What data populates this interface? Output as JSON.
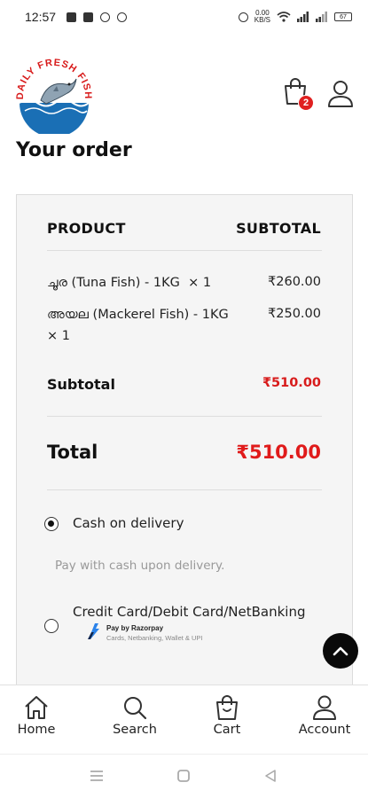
{
  "status_bar": {
    "time": "12:57",
    "speed_value": "0.00",
    "speed_unit": "KB/S",
    "network": "Vo LTE",
    "battery": "67"
  },
  "header": {
    "logo_text": "DAILY FRESH FISH",
    "cart_count": "2"
  },
  "page_title": "Your order",
  "order": {
    "col_product": "PRODUCT",
    "col_subtotal": "SUBTOTAL",
    "items": [
      {
        "name": "ചൂര (Tuna Fish) - 1KG",
        "qty": "× 1",
        "price": "₹260.00"
      },
      {
        "name": "അയല (Mackerel Fish) - 1KG",
        "qty": "× 1",
        "price": "₹250.00"
      }
    ],
    "subtotal_label": "Subtotal",
    "subtotal_value": "₹510.00",
    "total_label": "Total",
    "total_value": "₹510.00"
  },
  "payment": {
    "cod_label": "Cash on delivery",
    "cod_desc": "Pay with cash upon delivery.",
    "card_label": "Credit Card/Debit Card/NetBanking",
    "razorpay_title": "Pay by Razorpay",
    "razorpay_sub": "Cards, Netbanking, Wallet & UPI"
  },
  "bottom_nav": {
    "home": "Home",
    "search": "Search",
    "cart": "Cart",
    "account": "Account"
  },
  "colors": {
    "accent_red": "#e01b1b",
    "logo_blue": "#1a6fb5"
  }
}
